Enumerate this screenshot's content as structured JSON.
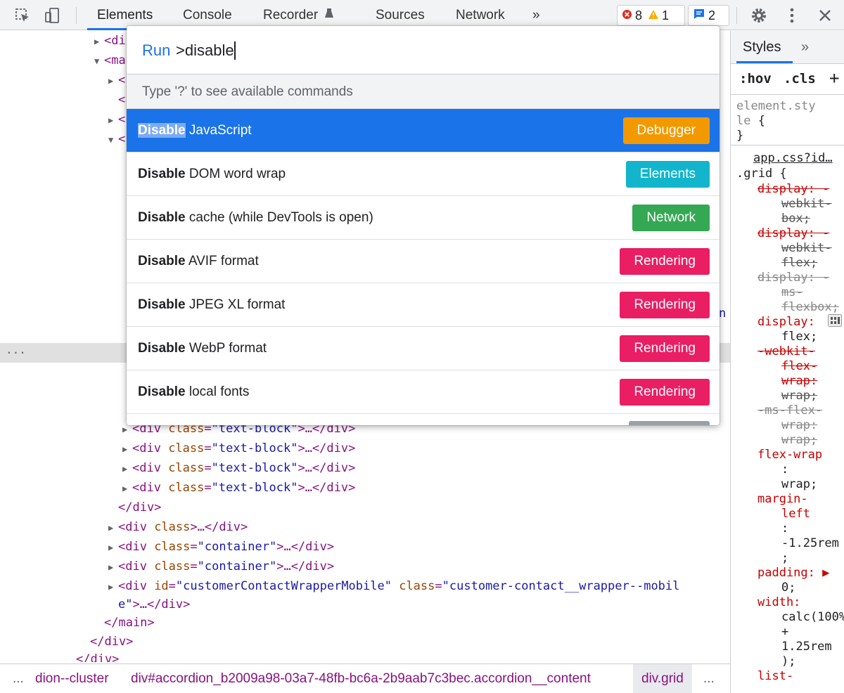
{
  "toolbar": {
    "tabs": [
      "Elements",
      "Console",
      "Recorder",
      "Sources",
      "Network"
    ],
    "more": "»",
    "errors": "8",
    "warnings": "1",
    "messages": "2"
  },
  "dom": {
    "lines": [
      {
        "tri": "▶",
        "open": "<",
        "tag": "di"
      },
      {
        "tri": "▼",
        "open": "<",
        "tag": "ma"
      },
      {
        "tri": "▶",
        "open": "<",
        "tag": ""
      },
      {
        "tri": "",
        "open": "<",
        "tag": ""
      },
      {
        "tri": "▶",
        "open": "<",
        "tag": ""
      },
      {
        "tri": "▼",
        "open": "<",
        "tag": ""
      },
      {
        "tri": "▶",
        "open": "<div ",
        "attr": "class",
        "val": "\"text-block\"",
        "close": ">…</div>"
      },
      {
        "tri": "▶",
        "open": "<div ",
        "attr": "class",
        "val": "\"text-block\"",
        "close": ">…</div>"
      },
      {
        "tri": "▶",
        "open": "<div ",
        "attr": "class",
        "val": "\"text-block\"",
        "close": ">…</div>"
      },
      {
        "tri": "▶",
        "open": "<div ",
        "attr": "class",
        "val": "\"text-block\"",
        "close": ">…</div>"
      },
      {
        "tri": "",
        "open": "</div>"
      },
      {
        "tri": "▶",
        "open": "<div ",
        "attr": "class",
        "close": ">…</div>"
      },
      {
        "tri": "▶",
        "open": "<div ",
        "attr": "class",
        "val": "\"container\"",
        "close": ">…</div>"
      },
      {
        "tri": "▶",
        "open": "<div ",
        "attr": "class",
        "val": "\"container\"",
        "close": ">…</div>"
      },
      {
        "tri": "▶",
        "open": "<div ",
        "attr": "id",
        "val": "\"customerContactWrapperMobile\"",
        "attr2": " class",
        "val2": "\"customer-contact__wrapper--mobil"
      },
      {
        "tri": "",
        "cont": "e\"",
        "close": ">…</div>"
      },
      {
        "tri": "",
        "open": "</main>"
      },
      {
        "tri": "",
        "open": "</div>"
      },
      {
        "tri": "",
        "open": "</div>"
      }
    ],
    "ellipsis": "...",
    "right_glyph": "n"
  },
  "breadcrumbs": {
    "ellipsis_left": "...",
    "items": [
      "dion--cluster",
      "div#accordion_b2009a98-03a7-48fb-bc6a-2b9aab7c3bec.accordion__content",
      "div.grid"
    ],
    "ellipsis_right": "..."
  },
  "styles": {
    "tab": "Styles",
    "more": "»",
    "hov": ":hov",
    "cls": ".cls",
    "add": "+",
    "element_style_1": "element.sty",
    "element_style_2": "le {",
    "element_style_close": "}",
    "source": "app.css?id…",
    "selector": ".grid {",
    "rules": [
      {
        "t": "display: -",
        "cls": "strike prop"
      },
      {
        "t": "webkit-",
        "cls": "strike",
        "indent": true
      },
      {
        "t": "box;",
        "cls": "strike",
        "indent": true
      },
      {
        "t": "display: -",
        "cls": "strike prop"
      },
      {
        "t": "webkit-",
        "cls": "strike",
        "indent": true
      },
      {
        "t": "flex;",
        "cls": "strike",
        "indent": true
      },
      {
        "t": "display: -",
        "cls": "strike dim"
      },
      {
        "t": "ms-",
        "cls": "strike dim",
        "indent": true
      },
      {
        "t": "flexbox;",
        "cls": "strike dim",
        "indent": true
      },
      {
        "t": "display:",
        "cls": "prop"
      },
      {
        "t": "flex;",
        "cls": "",
        "indent": true
      },
      {
        "t": "-webkit-",
        "cls": "strike prop"
      },
      {
        "t": "flex-",
        "cls": "strike prop",
        "indent": true
      },
      {
        "t": "wrap:",
        "cls": "strike prop",
        "indent": true
      },
      {
        "t": "wrap;",
        "cls": "strike",
        "indent": true
      },
      {
        "t": "-ms-flex-",
        "cls": "strike dim"
      },
      {
        "t": "wrap:",
        "cls": "strike dim",
        "indent": true
      },
      {
        "t": "wrap;",
        "cls": "strike dim",
        "indent": true
      },
      {
        "t": "flex-wrap",
        "cls": "prop"
      },
      {
        "t": ":",
        "cls": "",
        "indent": true
      },
      {
        "t": "wrap;",
        "cls": "",
        "indent": true
      },
      {
        "t": "margin-",
        "cls": "prop"
      },
      {
        "t": "left",
        "cls": "prop",
        "indent": true
      },
      {
        "t": ":",
        "cls": "",
        "indent": true
      },
      {
        "t": "-1.25rem",
        "cls": "",
        "indent": true
      },
      {
        "t": ";",
        "cls": "",
        "indent": true
      },
      {
        "t": "padding: ▶",
        "cls": "prop"
      },
      {
        "t": "0;",
        "cls": "",
        "indent": true
      },
      {
        "t": "width:",
        "cls": "prop"
      },
      {
        "t": "calc(100%",
        "cls": "",
        "indent": true
      },
      {
        "t": "+",
        "cls": "",
        "indent": true
      },
      {
        "t": "1.25rem",
        "cls": "",
        "indent": true
      },
      {
        "t": ");",
        "cls": "",
        "indent": true
      },
      {
        "t": "list-",
        "cls": "prop"
      }
    ]
  },
  "command_menu": {
    "prefix": "Run",
    "query": ">disable",
    "hint": "Type '?' to see available commands",
    "items": [
      {
        "bold": "Disable",
        "rest": " JavaScript",
        "category": "Debugger",
        "color": "#f29900",
        "selected": true
      },
      {
        "bold": "Disable",
        "rest": " DOM word wrap",
        "category": "Elements",
        "color": "#12b5cb"
      },
      {
        "bold": "Disable",
        "rest": " cache (while DevTools is open)",
        "category": "Network",
        "color": "#34a853"
      },
      {
        "bold": "Disable",
        "rest": " AVIF format",
        "category": "Rendering",
        "color": "#e91e63"
      },
      {
        "bold": "Disable",
        "rest": " JPEG XL format",
        "category": "Rendering",
        "color": "#e91e63"
      },
      {
        "bold": "Disable",
        "rest": " WebP format",
        "category": "Rendering",
        "color": "#e91e63"
      },
      {
        "bold": "Disable",
        "rest": " local fonts",
        "category": "Rendering",
        "color": "#e91e63"
      }
    ]
  }
}
